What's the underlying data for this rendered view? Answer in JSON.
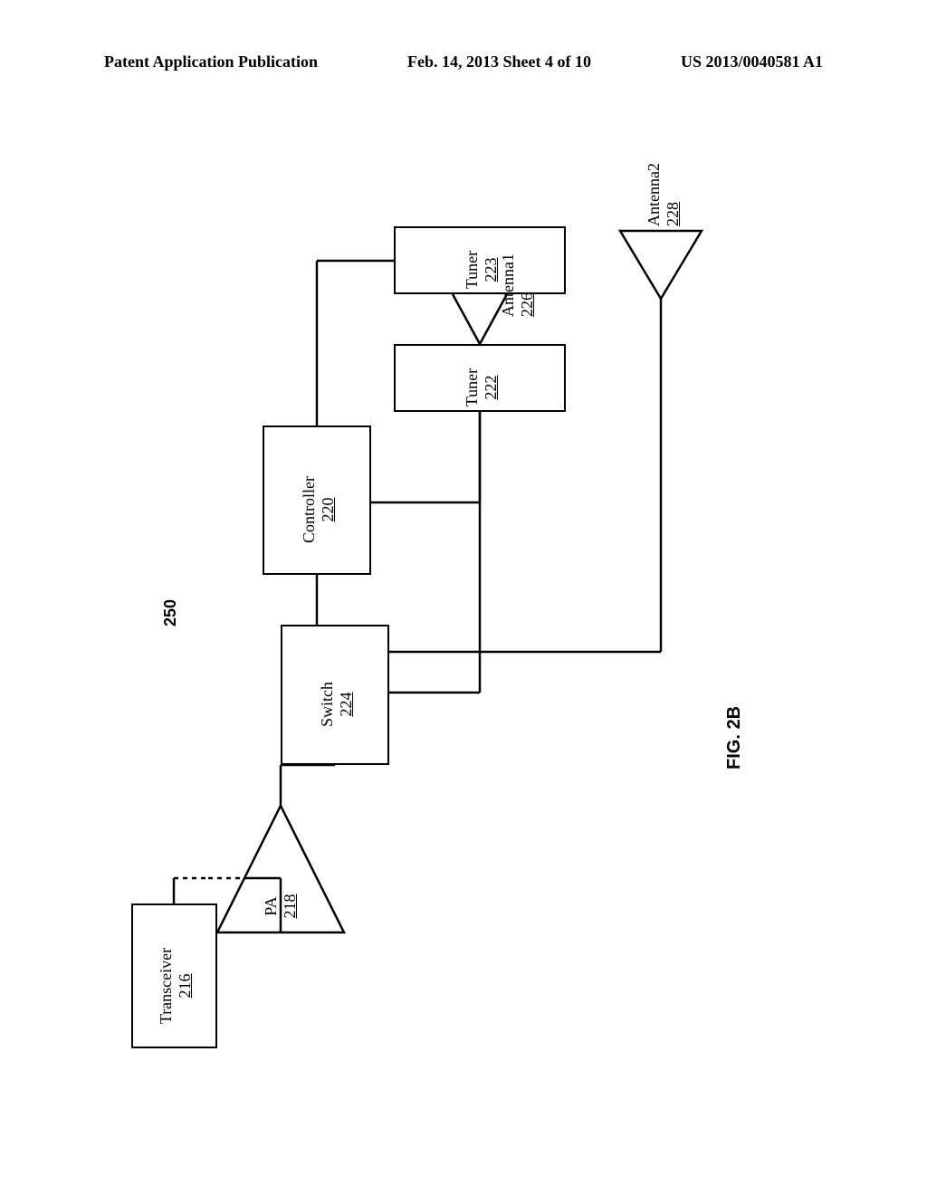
{
  "header": {
    "left": "Patent Application Publication",
    "center": "Feb. 14, 2013  Sheet 4 of 10",
    "right": "US 2013/0040581 A1"
  },
  "diagram": {
    "figure_ref": "250",
    "figure_label": "FIG. 2B",
    "blocks": {
      "transceiver": {
        "name": "Transceiver",
        "ref": "216"
      },
      "pa": {
        "name": "PA",
        "ref": "218"
      },
      "controller": {
        "name": "Controller",
        "ref": "220"
      },
      "tuner1": {
        "name": "Tuner",
        "ref": "222"
      },
      "tuner2": {
        "name": "Tuner",
        "ref": "223"
      },
      "switch": {
        "name": "Switch",
        "ref": "224"
      },
      "antenna1": {
        "name": "Antenna1",
        "ref": "226"
      },
      "antenna2": {
        "name": "Antenna2",
        "ref": "228"
      }
    }
  }
}
